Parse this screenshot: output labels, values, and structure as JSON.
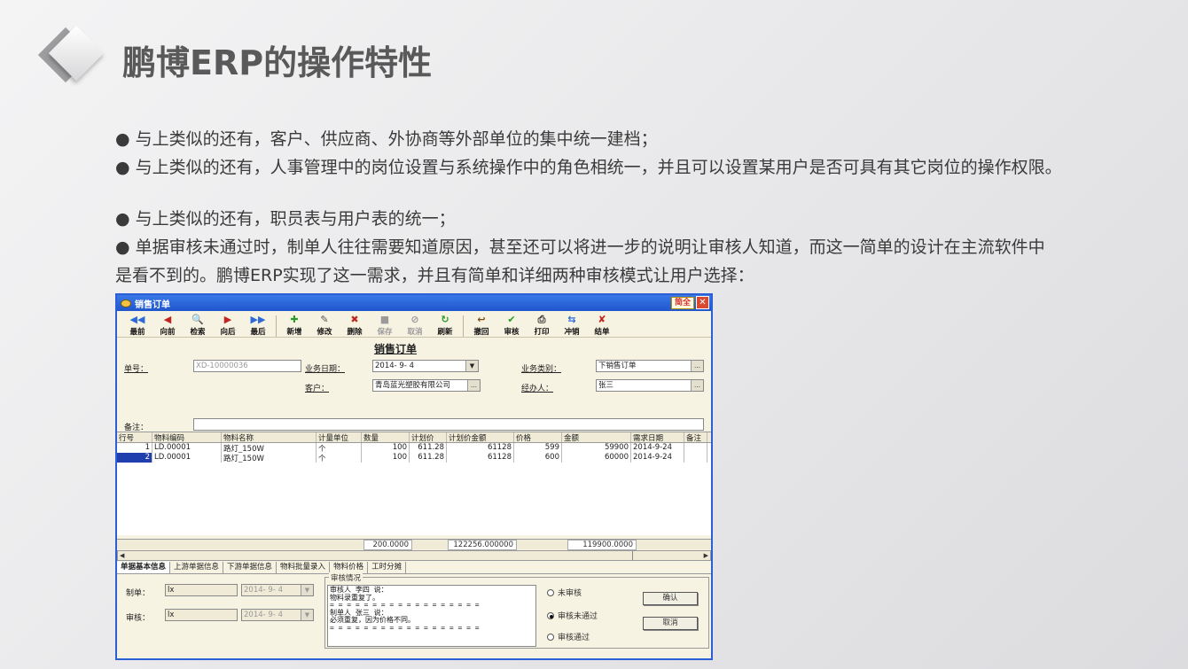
{
  "slide": {
    "title": "鹏博ERP的操作特性",
    "bullets": [
      "● 与上类似的还有，客户、供应商、外协商等外部单位的集中统一建档；",
      "● 与上类似的还有，人事管理中的岗位设置与系统操作中的角色相统一，并且可以设置某用户是否可具有其它岗位的操作权限。",
      "● 与上类似的还有，职员表与用户表的统一；",
      "● 单据审核未通过时，制单人往往需要知道原因，甚至还可以将进一步的说明让审核人知道，而这一简单的设计在主流软件中",
      "是看不到的。鹏博ERP实现了这一需求，并且有简单和详细两种审核模式让用户选择："
    ]
  },
  "window": {
    "title": "销售订单",
    "brand": "简全",
    "close": "✕"
  },
  "toolbar": [
    {
      "label": "最前",
      "icon": "◀◀",
      "color": "#2d6ad6"
    },
    {
      "label": "向前",
      "icon": "◀",
      "color": "#c2231d"
    },
    {
      "label": "检索",
      "icon": "🔍",
      "color": "#2d6ad6"
    },
    {
      "label": "向后",
      "icon": "▶",
      "color": "#c2231d"
    },
    {
      "label": "最后",
      "icon": "▶▶",
      "color": "#2d6ad6"
    },
    {
      "label": "新增",
      "icon": "✚",
      "color": "#2a9a2a"
    },
    {
      "label": "修改",
      "icon": "✎",
      "color": "#555555"
    },
    {
      "label": "删除",
      "icon": "✖",
      "color": "#c2231d"
    },
    {
      "label": "保存",
      "icon": "■",
      "color": "#9a9a9a"
    },
    {
      "label": "取消",
      "icon": "⊘",
      "color": "#9a9a9a"
    },
    {
      "label": "刷新",
      "icon": "↻",
      "color": "#2a9a2a"
    },
    {
      "label": "撤回",
      "icon": "↩",
      "color": "#7a4a10"
    },
    {
      "label": "审核",
      "icon": "✔",
      "color": "#2a9a2a"
    },
    {
      "label": "打印",
      "icon": "⎙",
      "color": "#333333"
    },
    {
      "label": "冲销",
      "icon": "⇆",
      "color": "#2d6ad6"
    },
    {
      "label": "结单",
      "icon": "✘",
      "color": "#c2231d"
    }
  ],
  "form": {
    "title": "销售订单",
    "order_no_label": "单号：",
    "order_no": "XD-10000036",
    "date_label": "业务日期：",
    "date": "2014- 9- 4",
    "type_label": "业务类别：",
    "type": "下销售订单",
    "customer_label": "客户：",
    "customer": "青岛蓝光塑胶有限公司",
    "handler_label": "经办人：",
    "handler": "张三",
    "remark_label": "备注："
  },
  "grid": {
    "headers": [
      "行号",
      "物料编码",
      "物料名称",
      "计量单位",
      "数量",
      "计划价",
      "计划价金额",
      "价格",
      "金额",
      "需求日期",
      "备注"
    ],
    "rows": [
      [
        "1",
        "LD.00001",
        "路灯_150W",
        "个",
        "100",
        "611.28",
        "61128",
        "599",
        "59900",
        "2014-9-24",
        ""
      ],
      [
        "2",
        "LD.00001",
        "路灯_150W",
        "个",
        "100",
        "611.28",
        "61128",
        "600",
        "60000",
        "2014-9-24",
        ""
      ]
    ],
    "totals": {
      "qty": "200.0000",
      "plan_amount": "122256.000000",
      "amount": "119900.0000"
    }
  },
  "tabs": [
    "单据基本信息",
    "上游单据信息",
    "下游单据信息",
    "物料批量录入",
    "物料价格",
    "工时分摊"
  ],
  "bottom": {
    "maker_label": "制单：",
    "maker": "lx",
    "maker_date": "2014- 9- 4",
    "auditor_label": "审核：",
    "auditor": "lx",
    "auditor_date": "2014- 9- 4",
    "audit_caption": "审核情况",
    "audit_text": "审核人 李四 说：\n物料录重复了。\n= = = = = = = = = = = = = = = = = =\n制单人 张三 说：\n必须重复，因为价格不同。\n= = = = = = = = = = = = = = = = = =",
    "radio_unreviewed": "未审核",
    "radio_failed": "审核未通过",
    "radio_passed": "审核通过",
    "confirm": "确认",
    "cancel": "取消"
  }
}
